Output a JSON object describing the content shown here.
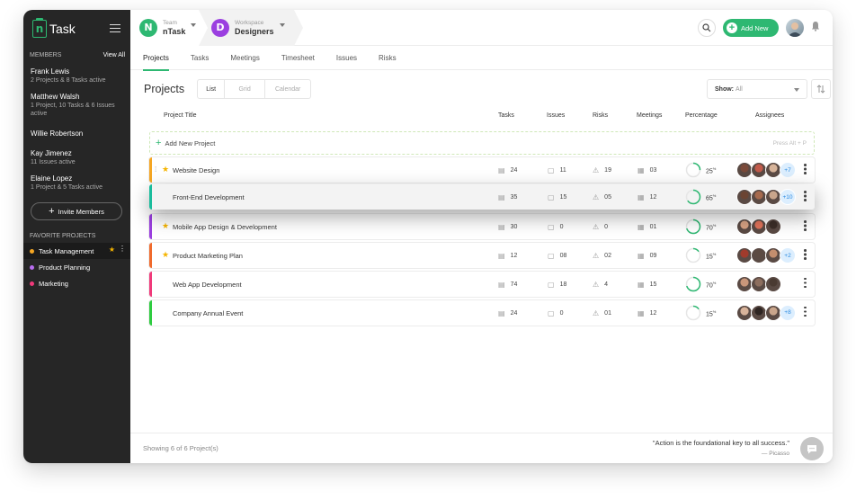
{
  "app": {
    "logo_text": "Task"
  },
  "sidebar": {
    "members_label": "MEMBERS",
    "view_all": "View All",
    "members": [
      {
        "name": "Frank Lewis",
        "info": "2 Projects & 8 Tasks active"
      },
      {
        "name": "Matthew Walsh",
        "info": "1 Project, 10 Tasks & 6 Issues active"
      },
      {
        "name": "Willie Robertson",
        "info": ""
      },
      {
        "name": "Kay Jimenez",
        "info": "11 Issues active"
      },
      {
        "name": "Elaine Lopez",
        "info": "1 Project & 5 Tasks active"
      }
    ],
    "invite_label": "Invite Members",
    "favorites_label": "FAVORITE PROJECTS",
    "favorites": [
      {
        "label": "Task Management",
        "color": "#f5a623"
      },
      {
        "label": "Product Planning",
        "color": "#b96ef0"
      },
      {
        "label": "Marketing",
        "color": "#f0397a"
      }
    ]
  },
  "header": {
    "team_label": "Team",
    "team_value": "nTask",
    "team_initial": "N",
    "team_color": "#2eb872",
    "workspace_label": "Workspace",
    "workspace_value": "Designers",
    "workspace_initial": "D",
    "workspace_color": "#9b3fe0",
    "add_new_label": "Add New"
  },
  "tabs": [
    "Projects",
    "Tasks",
    "Meetings",
    "Timesheet",
    "Issues",
    "Risks"
  ],
  "page": {
    "title": "Projects",
    "views": [
      "List",
      "Grid",
      "Calendar"
    ],
    "show_label": "Show:",
    "show_value": "All"
  },
  "table": {
    "headers": {
      "title": "Project Title",
      "tasks": "Tasks",
      "issues": "Issues",
      "risks": "Risks",
      "meetings": "Meetings",
      "percentage": "Percentage",
      "assignees": "Assignees"
    },
    "add_label": "Add New Project",
    "add_hint": "Press Alt + P",
    "rows": [
      {
        "name": "Website Design",
        "color": "#f5a623",
        "starred": true,
        "tasks": "24",
        "issues": "11",
        "risks": "19",
        "meetings": "03",
        "percent": "25",
        "extra": "+7"
      },
      {
        "name": "Front-End Development",
        "color": "#1abc9c",
        "starred": false,
        "tasks": "35",
        "issues": "15",
        "risks": "05",
        "meetings": "12",
        "percent": "65",
        "extra": "+10"
      },
      {
        "name": "Mobile App Design & Development",
        "color": "#9b3fe0",
        "starred": true,
        "tasks": "30",
        "issues": "0",
        "risks": "0",
        "meetings": "01",
        "percent": "70",
        "extra": ""
      },
      {
        "name": "Product Marketing Plan",
        "color": "#f06a2c",
        "starred": true,
        "tasks": "12",
        "issues": "08",
        "risks": "02",
        "meetings": "09",
        "percent": "15",
        "extra": "+2"
      },
      {
        "name": "Web App Development",
        "color": "#f0397a",
        "starred": false,
        "tasks": "74",
        "issues": "18",
        "risks": "4",
        "meetings": "15",
        "percent": "70",
        "extra": ""
      },
      {
        "name": "Company Annual Event",
        "color": "#2ecc40",
        "starred": false,
        "tasks": "24",
        "issues": "0",
        "risks": "01",
        "meetings": "12",
        "percent": "15",
        "extra": "+8"
      }
    ]
  },
  "footer": {
    "showing": "Showing 6 of 6 Project(s)",
    "quote": "\"Action is the foundational key to all success.\"",
    "author": "— Picasso"
  }
}
